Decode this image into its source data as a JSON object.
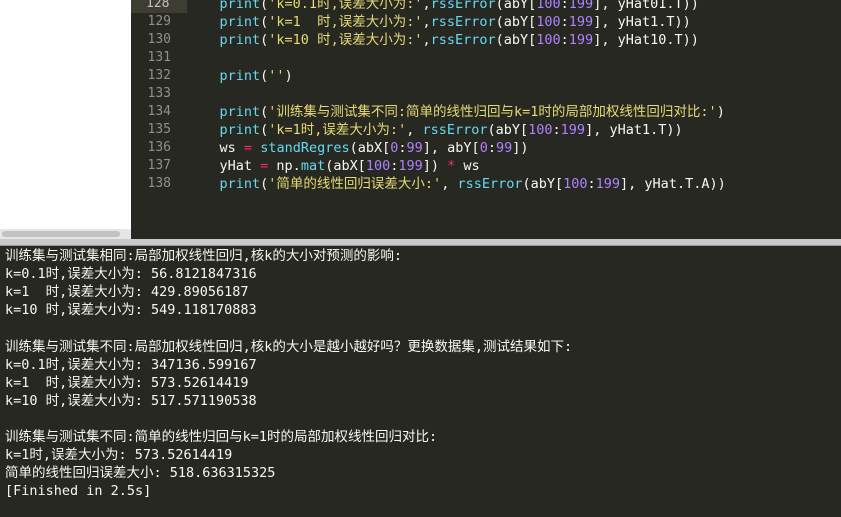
{
  "editor": {
    "lines": [
      {
        "no": "128",
        "current": true,
        "segments": [
          {
            "t": "    "
          },
          {
            "t": "print",
            "c": "kw"
          },
          {
            "t": "("
          },
          {
            "t": "'k=0.1时,误差大小为:'",
            "c": "str"
          },
          {
            "t": ","
          },
          {
            "t": "rssError",
            "c": "kw"
          },
          {
            "t": "(abY["
          },
          {
            "t": "100",
            "c": "num"
          },
          {
            "t": ":"
          },
          {
            "t": "199",
            "c": "num"
          },
          {
            "t": "], yHat01.T))"
          }
        ]
      },
      {
        "no": "129",
        "segments": [
          {
            "t": "    "
          },
          {
            "t": "print",
            "c": "kw"
          },
          {
            "t": "("
          },
          {
            "t": "'k=1  时,误差大小为:'",
            "c": "str"
          },
          {
            "t": ","
          },
          {
            "t": "rssError",
            "c": "kw"
          },
          {
            "t": "(abY["
          },
          {
            "t": "100",
            "c": "num"
          },
          {
            "t": ":"
          },
          {
            "t": "199",
            "c": "num"
          },
          {
            "t": "], yHat1.T))"
          }
        ]
      },
      {
        "no": "130",
        "segments": [
          {
            "t": "    "
          },
          {
            "t": "print",
            "c": "kw"
          },
          {
            "t": "("
          },
          {
            "t": "'k=10 时,误差大小为:'",
            "c": "str"
          },
          {
            "t": ","
          },
          {
            "t": "rssError",
            "c": "kw"
          },
          {
            "t": "(abY["
          },
          {
            "t": "100",
            "c": "num"
          },
          {
            "t": ":"
          },
          {
            "t": "199",
            "c": "num"
          },
          {
            "t": "], yHat10.T))"
          }
        ]
      },
      {
        "no": "131",
        "segments": []
      },
      {
        "no": "132",
        "segments": [
          {
            "t": "    "
          },
          {
            "t": "print",
            "c": "kw"
          },
          {
            "t": "("
          },
          {
            "t": "''",
            "c": "str"
          },
          {
            "t": ")"
          }
        ]
      },
      {
        "no": "133",
        "segments": []
      },
      {
        "no": "134",
        "segments": [
          {
            "t": "    "
          },
          {
            "t": "print",
            "c": "kw"
          },
          {
            "t": "("
          },
          {
            "t": "'训练集与测试集不同:简单的线性归回与k=1时的局部加权线性回归对比:'",
            "c": "str"
          },
          {
            "t": ")"
          }
        ]
      },
      {
        "no": "135",
        "segments": [
          {
            "t": "    "
          },
          {
            "t": "print",
            "c": "kw"
          },
          {
            "t": "("
          },
          {
            "t": "'k=1时,误差大小为:'",
            "c": "str"
          },
          {
            "t": ", "
          },
          {
            "t": "rssError",
            "c": "kw"
          },
          {
            "t": "(abY["
          },
          {
            "t": "100",
            "c": "num"
          },
          {
            "t": ":"
          },
          {
            "t": "199",
            "c": "num"
          },
          {
            "t": "], yHat1.T))"
          }
        ]
      },
      {
        "no": "136",
        "segments": [
          {
            "t": "    ws "
          },
          {
            "t": "=",
            "c": "op"
          },
          {
            "t": " "
          },
          {
            "t": "standRegres",
            "c": "kw"
          },
          {
            "t": "(abX["
          },
          {
            "t": "0",
            "c": "num"
          },
          {
            "t": ":"
          },
          {
            "t": "99",
            "c": "num"
          },
          {
            "t": "], abY["
          },
          {
            "t": "0",
            "c": "num"
          },
          {
            "t": ":"
          },
          {
            "t": "99",
            "c": "num"
          },
          {
            "t": "])"
          }
        ]
      },
      {
        "no": "137",
        "segments": [
          {
            "t": "    yHat "
          },
          {
            "t": "=",
            "c": "op"
          },
          {
            "t": " np."
          },
          {
            "t": "mat",
            "c": "kw"
          },
          {
            "t": "(abX["
          },
          {
            "t": "100",
            "c": "num"
          },
          {
            "t": ":"
          },
          {
            "t": "199",
            "c": "num"
          },
          {
            "t": "]) "
          },
          {
            "t": "*",
            "c": "op"
          },
          {
            "t": " ws"
          }
        ]
      },
      {
        "no": "138",
        "segments": [
          {
            "t": "    "
          },
          {
            "t": "print",
            "c": "kw"
          },
          {
            "t": "("
          },
          {
            "t": "'简单的线性回归误差大小:'",
            "c": "str"
          },
          {
            "t": ", "
          },
          {
            "t": "rssError",
            "c": "kw"
          },
          {
            "t": "(abY["
          },
          {
            "t": "100",
            "c": "num"
          },
          {
            "t": ":"
          },
          {
            "t": "199",
            "c": "num"
          },
          {
            "t": "], yHat.T.A))"
          }
        ]
      }
    ]
  },
  "output": {
    "lines": [
      "训练集与测试集相同:局部加权线性回归,核k的大小对预测的影响:",
      "k=0.1时,误差大小为: 56.8121847316",
      "k=1  时,误差大小为: 429.89056187",
      "k=10 时,误差大小为: 549.118170883",
      "",
      "训练集与测试集不同:局部加权线性回归,核k的大小是越小越好吗？更换数据集,测试结果如下:",
      "k=0.1时,误差大小为: 347136.599167",
      "k=1  时,误差大小为: 573.52614419",
      "k=10 时,误差大小为: 517.571190538",
      "",
      "训练集与测试集不同:简单的线性归回与k=1时的局部加权线性回归对比:",
      "k=1时,误差大小为: 573.52614419",
      "简单的线性回归误差大小: 518.636315325",
      "[Finished in 2.5s]"
    ]
  }
}
